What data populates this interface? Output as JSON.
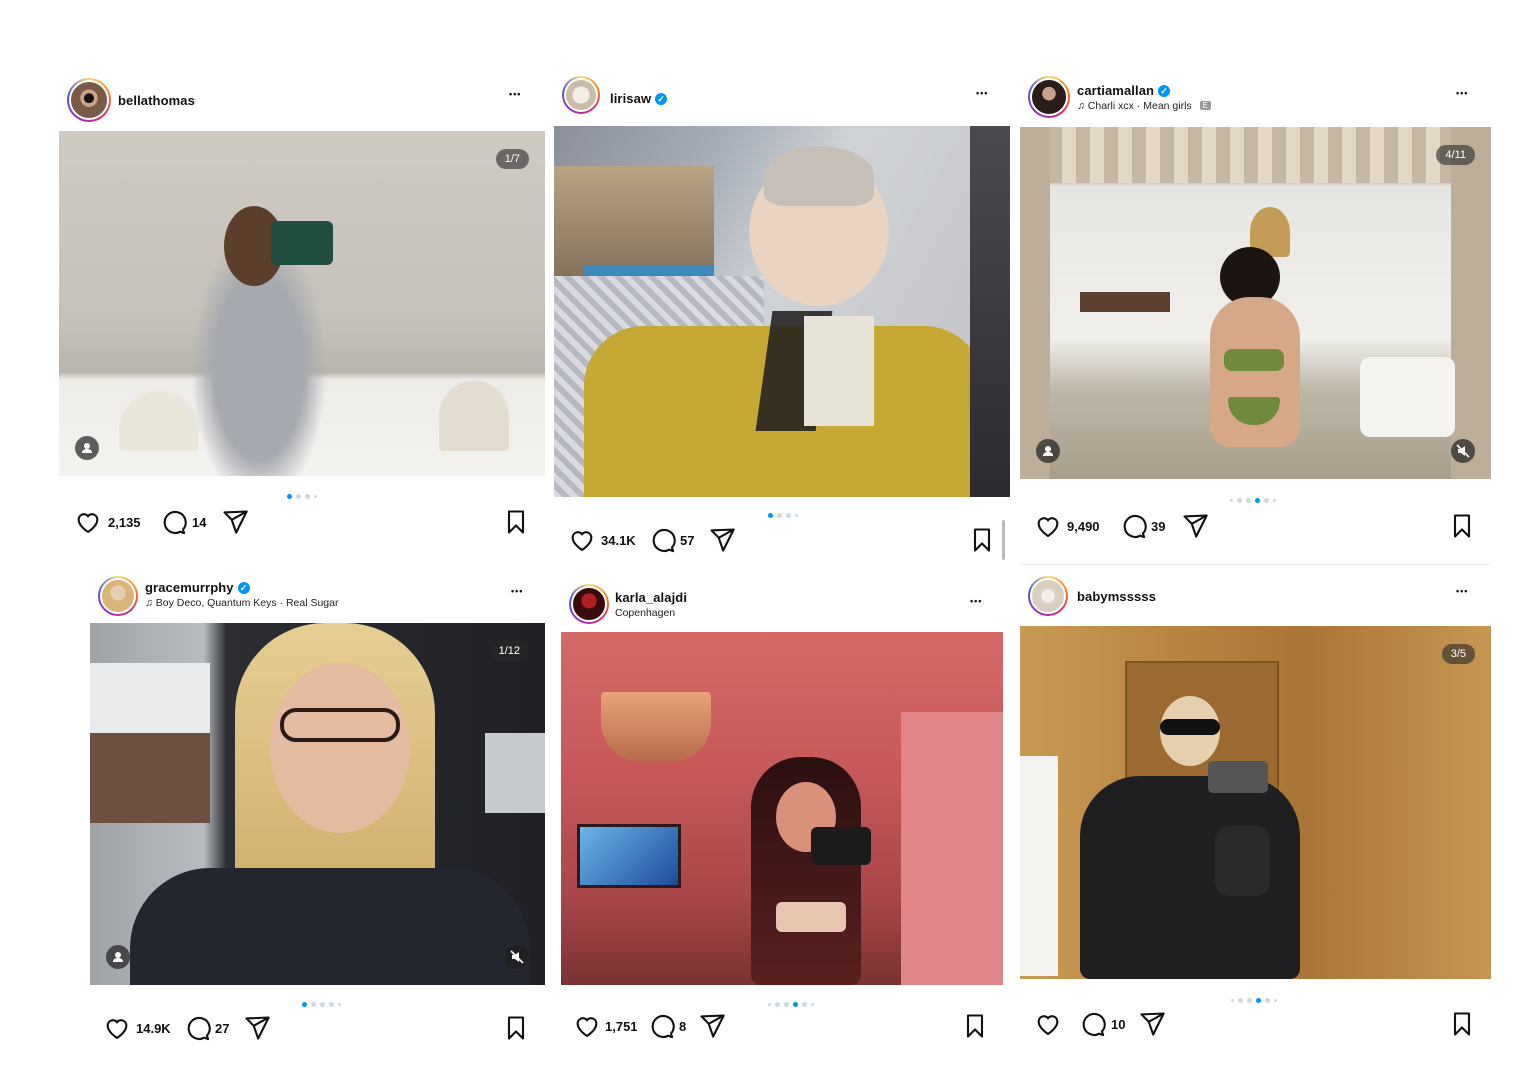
{
  "posts": [
    {
      "username": "bellathomas",
      "verified": false,
      "subtitle": "",
      "counter": "1/7",
      "likes": "2,135",
      "comments": "14",
      "avatar_color": "#2b2320"
    },
    {
      "username": "lirisaw",
      "verified": true,
      "subtitle": "",
      "counter": "",
      "likes": "34.1K",
      "comments": "57",
      "avatar_color": "#d8cfc4"
    },
    {
      "username": "cartiamallan",
      "verified": true,
      "music_artist": "Charli xcx",
      "music_title": "Mean girls",
      "music_separator": "·",
      "explicit_badge": "E",
      "counter": "4/11",
      "likes": "9,490",
      "comments": "39",
      "avatar_color": "#3a2a24"
    },
    {
      "username": "gracemurrphy",
      "verified": true,
      "music_artist": "Boy Deco, Quantum Keys",
      "music_title": "Real Sugar",
      "music_separator": "·",
      "counter": "1/12",
      "likes": "14.9K",
      "comments": "27",
      "avatar_color": "#d7c3a8"
    },
    {
      "username": "karla_alajdi",
      "verified": false,
      "subtitle": "Copenhagen",
      "counter": "",
      "likes": "1,751",
      "comments": "8",
      "avatar_color": "#6a1414"
    },
    {
      "username": "babymsssss",
      "verified": false,
      "subtitle": "",
      "counter": "3/5",
      "likes": "",
      "comments": "10",
      "avatar_color": "#e8e0d4"
    }
  ],
  "more_label": "•••",
  "icons": {
    "like": "heart-icon",
    "comment": "comment-icon",
    "share": "send-icon",
    "save": "bookmark-icon",
    "tag": "person-icon",
    "mute": "muted-speaker-icon",
    "music": "music-note-icon"
  },
  "colors": {
    "accent": "#0095f6",
    "dot_inactive": "#cfd8e2"
  }
}
